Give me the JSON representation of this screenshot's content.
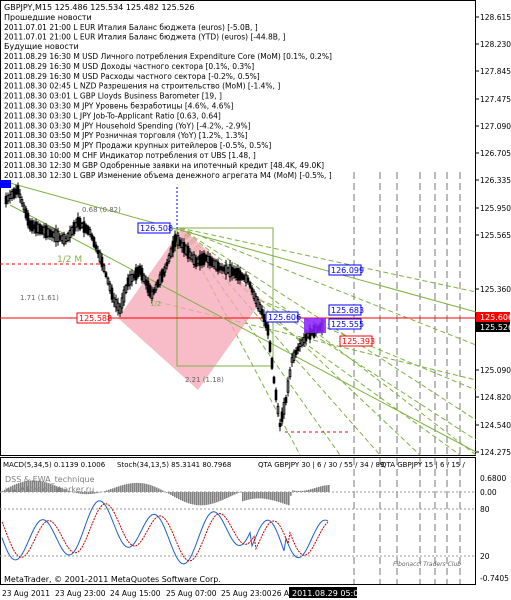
{
  "header": {
    "title": "GBPJPY,M15  125.486 125.534 125.482 125.526"
  },
  "news": {
    "past_title": "Прошедшие новости",
    "past": [
      "2011.07.01 21:00 L EUR Италия Баланс бюджета (euros) [-5.0B, ]",
      "2011.07.01 21:00 L EUR Италия Баланс бюджета (YTD) (euros) [-44.8B, ]"
    ],
    "future_title": "Будущие новости",
    "future": [
      "2011.08.29 16:30 M USD Личного потребления Expenditure Core (MoM) [0.1%, 0.2%]",
      "2011.08.29 16:30 M USD Доходы частного сектора [0.1%, 0.3%]",
      "2011.08.29 16:30 M USD Расходы частного сектора [-0.2%, 0.5%]",
      "2011.08.30 02:45 L NZD Разрешения на строительство (MoM) [-1.4%, ]",
      "2011.08.30 03:01 L GBP Lloyds Business Barometer [19, ]",
      "2011.08.30 03:30 M JPY Уровень безработицы [4.6%, 4.6%]",
      "2011.08.30 03:30 L JPY Job-To-Applicant Ratio [0.63, 0.64]",
      "2011.08.30 03:30 M JPY Household Spending (YoY) [-4.2%, -2.9%]",
      "2011.08.30 03:50 M JPY Розничная торговля (YoY) [1.2%, 1.3%]",
      "2011.08.30 03:50 M JPY Продажи крупных ритейлеров [-0.5%, 0.5%]",
      "2011.08.30 10:00 M CHF Индикатор потребления от UBS [1.48, ]",
      "2011.08.30 12:30 M GBP Одобренные заявки на ипотечный кредит [48.4K, 49.0K]",
      "2011.08.30 12:30 L GBP Изменение объема денежного агрегата M4 (MoM) [-0.5%, ]"
    ]
  },
  "price_scale": [
    "128.615",
    "128.230",
    "127.845",
    "127.475",
    "127.090",
    "126.705",
    "126.335",
    "125.950",
    "125.565",
    "125.360",
    "125.090",
    "124.820",
    "124.540",
    "124.275"
  ],
  "price_tag_current": "125.526",
  "price_tag_line": "125.606",
  "level_labels": {
    "l1": "126.508",
    "l2": "125.588",
    "l3": "126.099",
    "l4": "125.683",
    "l5": "125.555",
    "l6": "125.606",
    "l7": "125.393"
  },
  "fib_text": {
    "a": "0.68 (0.82)",
    "b": "1.71 (1.61)",
    "c": "1/2 M",
    "d": "2.21 (1.18)",
    "e": "1/2"
  },
  "indicator": {
    "label_macd": "MACD(5,34,5) 0.1139 0.1006",
    "label_stoch": "Stoch(34,13,5) 85.3141 80.7968",
    "label_sym": "QTA GBPJPY 30 | 6 / 30 / 55 / 34 / 89",
    "label_sym2": "QTA GBPJPY 15 | 6 / 15 / ",
    "subtitle": "DSS & EWA_technique",
    "site": "www.forex-sakarker.ru",
    "scale": [
      "0.6800",
      "0.00",
      "80",
      "20",
      "-0.7405"
    ],
    "watermark": "Fibonacci Traders Club"
  },
  "footer": {
    "copyright": "MetaTrader, © 2001-2011 MetaQuotes Software Corp.",
    "time_labels": [
      "23 Aug 2011",
      "23 Aug 23:00",
      "24 Aug 15:00",
      "25 Aug 07:00",
      "25 Aug 23:00",
      "26 A"
    ],
    "time_current": "2011.08.29 05:02"
  },
  "colors": {
    "bg": "#ffffff",
    "candle": "#000000",
    "red_line": "#ff0000",
    "blue_box": "#0000ff",
    "green_lines": "#7fb241",
    "pink": "#f4a6b4",
    "purple": "#7f00ff",
    "gray_hist": "#808080"
  }
}
